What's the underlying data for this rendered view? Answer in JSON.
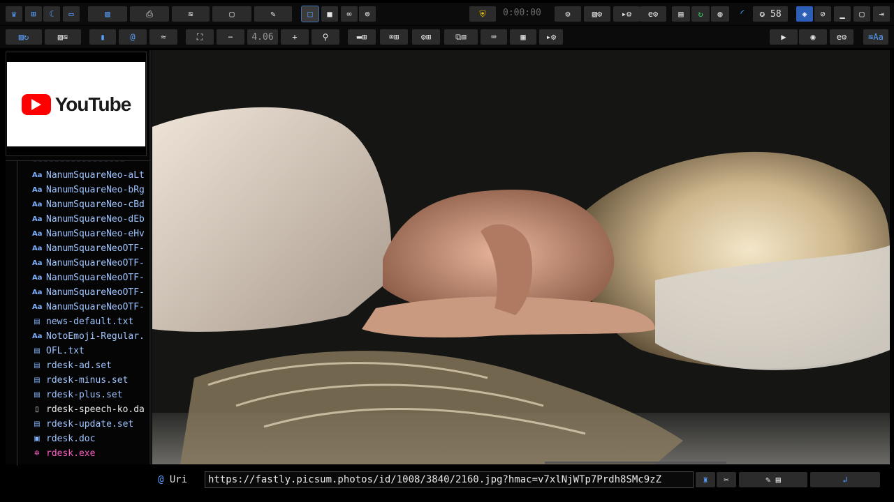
{
  "toolbar": {
    "timer": "0:00:00",
    "counter": "58",
    "zoom": "4.06"
  },
  "sidebar": {
    "items": [
      {
        "icon": "Aa",
        "label": "NanumSquareNeo-aLt",
        "kind": "font"
      },
      {
        "icon": "Aa",
        "label": "NanumSquareNeo-bRg",
        "kind": "font"
      },
      {
        "icon": "Aa",
        "label": "NanumSquareNeo-cBd",
        "kind": "font"
      },
      {
        "icon": "Aa",
        "label": "NanumSquareNeo-dEb",
        "kind": "font"
      },
      {
        "icon": "Aa",
        "label": "NanumSquareNeo-eHv",
        "kind": "font"
      },
      {
        "icon": "Aa",
        "label": "NanumSquareNeoOTF-",
        "kind": "font"
      },
      {
        "icon": "Aa",
        "label": "NanumSquareNeoOTF-",
        "kind": "font"
      },
      {
        "icon": "Aa",
        "label": "NanumSquareNeoOTF-",
        "kind": "font"
      },
      {
        "icon": "Aa",
        "label": "NanumSquareNeoOTF-",
        "kind": "font"
      },
      {
        "icon": "Aa",
        "label": "NanumSquareNeoOTF-",
        "kind": "font"
      },
      {
        "icon": "▤",
        "label": "news-default.txt",
        "kind": "doc"
      },
      {
        "icon": "Aa",
        "label": "NotoEmoji-Regular.",
        "kind": "font"
      },
      {
        "icon": "▤",
        "label": "OFL.txt",
        "kind": "doc"
      },
      {
        "icon": "▤",
        "label": "rdesk-ad.set",
        "kind": "doc"
      },
      {
        "icon": "▤",
        "label": "rdesk-minus.set",
        "kind": "doc"
      },
      {
        "icon": "▤",
        "label": "rdesk-plus.set",
        "kind": "doc"
      },
      {
        "icon": "▯",
        "label": "rdesk-speech-ko.da",
        "kind": "plain"
      },
      {
        "icon": "▤",
        "label": "rdesk-update.set",
        "kind": "doc"
      },
      {
        "icon": "▣",
        "label": "rdesk.doc",
        "kind": "doc"
      },
      {
        "icon": "✲",
        "label": "rdesk.exe",
        "kind": "exe"
      }
    ]
  },
  "thumbnail": {
    "brand": "YouTube"
  },
  "bottom": {
    "uri_label": "Uri",
    "uri_value": "https://fastly.picsum.photos/id/1008/3840/2160.jpg?hmac=v7xlNjWTp7Prdh8SMc9zZ"
  },
  "colors": {
    "accent": "#2c5fb5",
    "link": "#9fc4ff",
    "exe": "#ff5cc8"
  }
}
